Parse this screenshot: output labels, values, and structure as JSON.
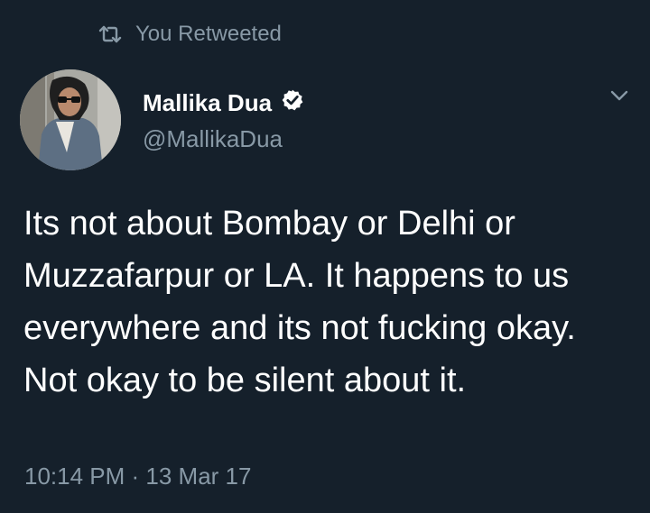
{
  "retweet_banner": {
    "label": "You Retweeted",
    "icon": "retweet-icon"
  },
  "author": {
    "display_name": "Mallika Dua",
    "handle": "@MallikaDua",
    "verified": true,
    "verified_icon": "verified-badge-icon"
  },
  "tweet": {
    "text": "Its not about Bombay or Delhi or Muzzafarpur or LA. It happens to us everywhere and its not fucking okay. Not okay to be silent about it.",
    "timestamp": "10:14 PM · 13 Mar 17"
  },
  "menu_icon": "chevron-down-icon",
  "colors": {
    "background": "#15202b",
    "primary_text": "#ffffff",
    "secondary_text": "#8899a6"
  }
}
